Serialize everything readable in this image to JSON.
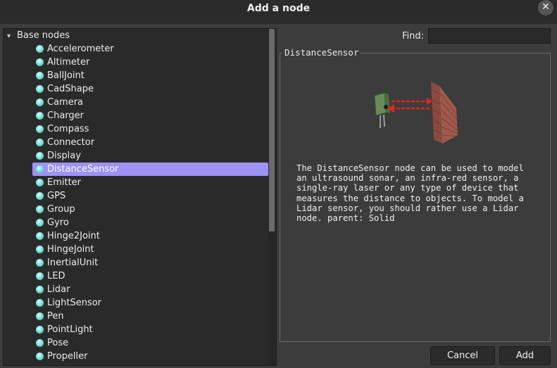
{
  "window": {
    "title": "Add a node",
    "close_glyph": "✕"
  },
  "tree": {
    "root_label": "Base nodes",
    "selected_index": 9,
    "items": [
      "Accelerometer",
      "Altimeter",
      "BallJoint",
      "CadShape",
      "Camera",
      "Charger",
      "Compass",
      "Connector",
      "Display",
      "DistanceSensor",
      "Emitter",
      "GPS",
      "Group",
      "Gyro",
      "Hinge2Joint",
      "HingeJoint",
      "InertialUnit",
      "LED",
      "Lidar",
      "LightSensor",
      "Pen",
      "PointLight",
      "Pose",
      "Propeller"
    ]
  },
  "find": {
    "label": "Find:",
    "value": ""
  },
  "info": {
    "title": "DistanceSensor",
    "description": "The DistanceSensor node can be used to model\nan ultrasound sonar, an infra-red sensor, a\nsingle-ray laser or any type of device that\nmeasures the distance to objects. To model a\nLidar sensor, you should rather use a Lidar\nnode. parent: Solid"
  },
  "buttons": {
    "cancel": "Cancel",
    "add": "Add"
  },
  "colors": {
    "selection": "#9d93f5",
    "node_dot": "#7be3d6",
    "background": "#3c3c3c"
  }
}
